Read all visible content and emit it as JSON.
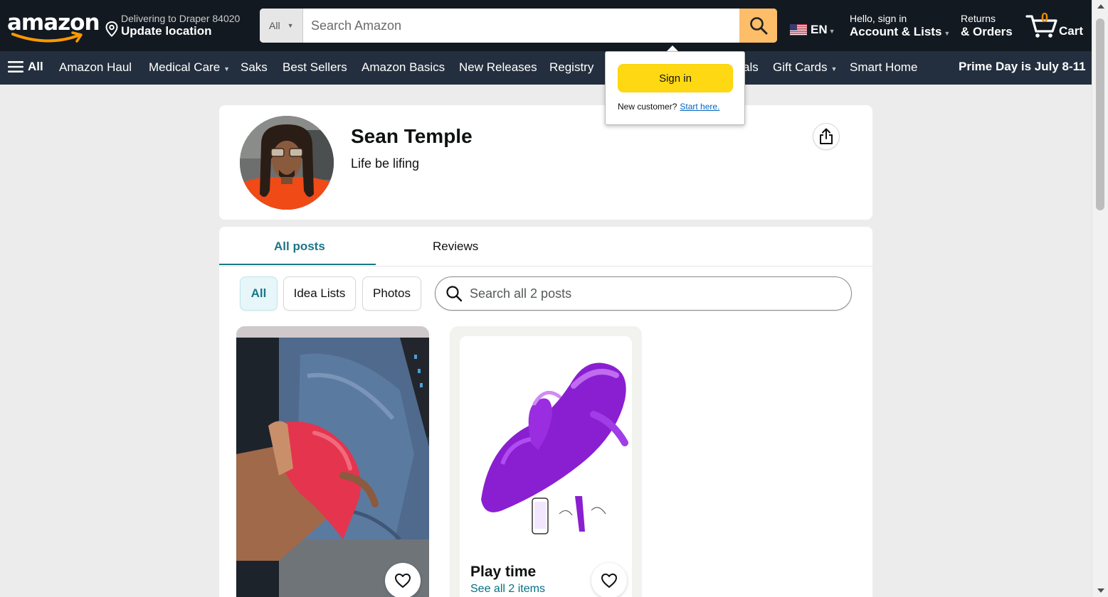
{
  "header": {
    "logo_text": "amazon",
    "delivery": {
      "line1": "Delivering to Draper 84020",
      "line2": "Update location"
    },
    "search": {
      "category": "All",
      "placeholder": "Search Amazon"
    },
    "language": {
      "code": "EN",
      "flag": "us-flag-icon"
    },
    "account": {
      "line1": "Hello, sign in",
      "line2": "Account & Lists"
    },
    "returns": {
      "line1": "Returns",
      "line2": "& Orders"
    },
    "cart": {
      "count": "0",
      "label": "Cart"
    }
  },
  "subnav": {
    "all_label": "All",
    "items": [
      "Amazon Haul",
      "Medical Care",
      "Saks",
      "Best Sellers",
      "Amazon Basics",
      "New Releases",
      "Registry",
      "als",
      "Gift Cards",
      "Smart Home"
    ],
    "promo": "Prime Day is July 8-11"
  },
  "signin_flyout": {
    "button": "Sign in",
    "new_customer": "New customer?",
    "start_here": "Start here."
  },
  "profile": {
    "name": "Sean Temple",
    "bio": "Life be lifing"
  },
  "posts": {
    "tabs": [
      {
        "label": "All posts",
        "active": true
      },
      {
        "label": "Reviews",
        "active": false
      }
    ],
    "filters": [
      {
        "label": "All",
        "active": true
      },
      {
        "label": "Idea Lists",
        "active": false
      },
      {
        "label": "Photos",
        "active": false
      }
    ],
    "search_placeholder": "Search all 2 posts",
    "items": [
      {
        "type": "photo"
      },
      {
        "type": "idea-list",
        "title": "Play time",
        "link": "See all 2 items"
      }
    ]
  },
  "colors": {
    "nav_dark": "#131921",
    "nav_sub": "#232f3e",
    "search_button": "#febd69",
    "cart_count": "#f08804",
    "signin_button": "#ffd814",
    "teal_accent": "#1b7688",
    "link": "#007185"
  }
}
